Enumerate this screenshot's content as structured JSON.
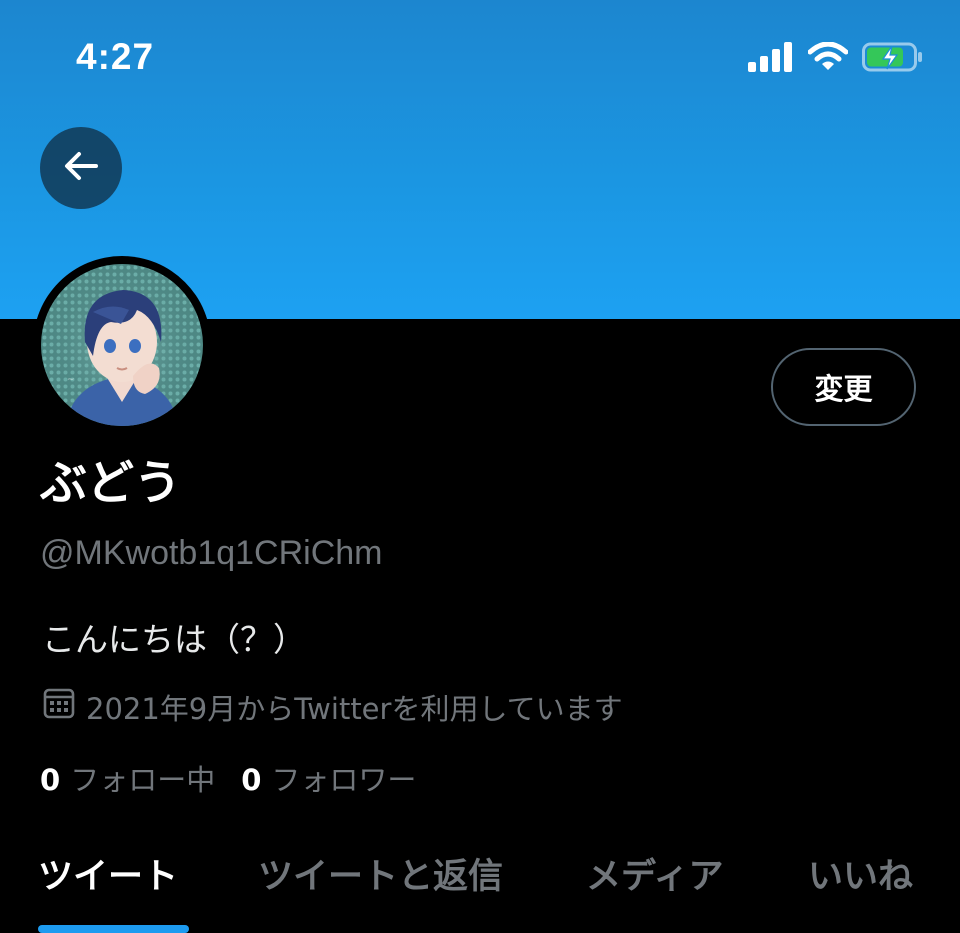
{
  "status_bar": {
    "time": "4:27",
    "icons": [
      "signal-icon",
      "wifi-icon",
      "battery-charging-icon"
    ]
  },
  "header": {
    "banner_color": "#1da1f2",
    "back_icon": "arrow-left-icon"
  },
  "profile": {
    "edit_label": "変更",
    "display_name": "ぶどう",
    "handle": "@MKwotb1q1CRiChm",
    "bio": "こんにちは（？）",
    "joined_icon": "calendar-icon",
    "joined_text": "2021年9月からTwitterを利用しています",
    "following_count": "0",
    "following_label": "フォロー中",
    "followers_count": "0",
    "followers_label": "フォロワー"
  },
  "tabs": [
    {
      "label": "ツイート",
      "active": true
    },
    {
      "label": "ツイートと返信",
      "active": false
    },
    {
      "label": "メディア",
      "active": false
    },
    {
      "label": "いいね",
      "active": false
    }
  ],
  "colors": {
    "accent": "#1d9bf0",
    "background": "#000000",
    "secondary_text": "#71767b",
    "battery_fill": "#34c759"
  }
}
